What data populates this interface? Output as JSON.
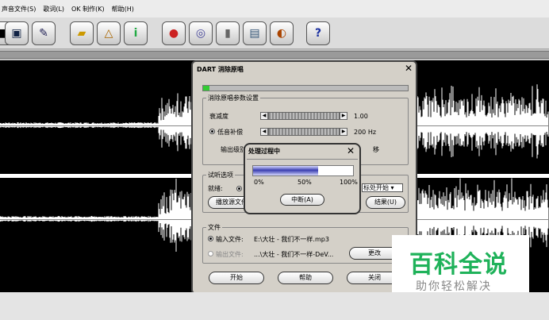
{
  "menubar": {
    "items": [
      "声音文件(S)",
      "歌词(L)",
      "OK 制作(K)",
      "帮助(H)"
    ]
  },
  "toolbar": {
    "icons": [
      "open-icon",
      "save-icon",
      "tool-icon",
      "folder-icon",
      "edit-icon",
      "info-icon",
      "mute-icon",
      "cd-icon",
      "record-icon",
      "doc-icon",
      "dial-icon",
      "help-icon"
    ],
    "help_label": "?",
    "info_label": "i"
  },
  "dialog": {
    "title": "DART 消除原唱",
    "group_params": "消除原唱参数设置",
    "attenuation_label": "衰减度",
    "attenuation_value": "1.00",
    "lowfreq_label": "低音补偿",
    "lowfreq_value": "200 Hz",
    "output_label": "输出级别",
    "output_value_suffix": "移",
    "group_listen": "试听选项",
    "ready_label": "就绪:",
    "cursor_start": "标处开始",
    "play_source": "播放源文件",
    "play_result": "结果(U)",
    "group_file": "文件",
    "input_label": "输入文件:",
    "input_value": "E:\\大壮 - 我们不一样.mp3",
    "output_file_label": "输出文件:",
    "output_file_value": "...\\大壮 - 我们不一样-DeV...",
    "change_button": "更改",
    "start_button": "开始",
    "help_button": "帮助",
    "close_button": "关闭",
    "close_x": "✕"
  },
  "progress": {
    "title": "处理过程中",
    "close_x": "✕",
    "tick_0": "0%",
    "tick_50": "50%",
    "tick_100": "100%",
    "fraction": 0.65,
    "interrupt_button": "中断(A)"
  },
  "watermark": {
    "brand": "百科全说",
    "slogan": "助你轻松解决"
  },
  "colors": {
    "wave": "#ffffff",
    "bg_wave": "#000000",
    "brand_green": "#1fb25a",
    "progress_blue": "#3a3fb0"
  }
}
